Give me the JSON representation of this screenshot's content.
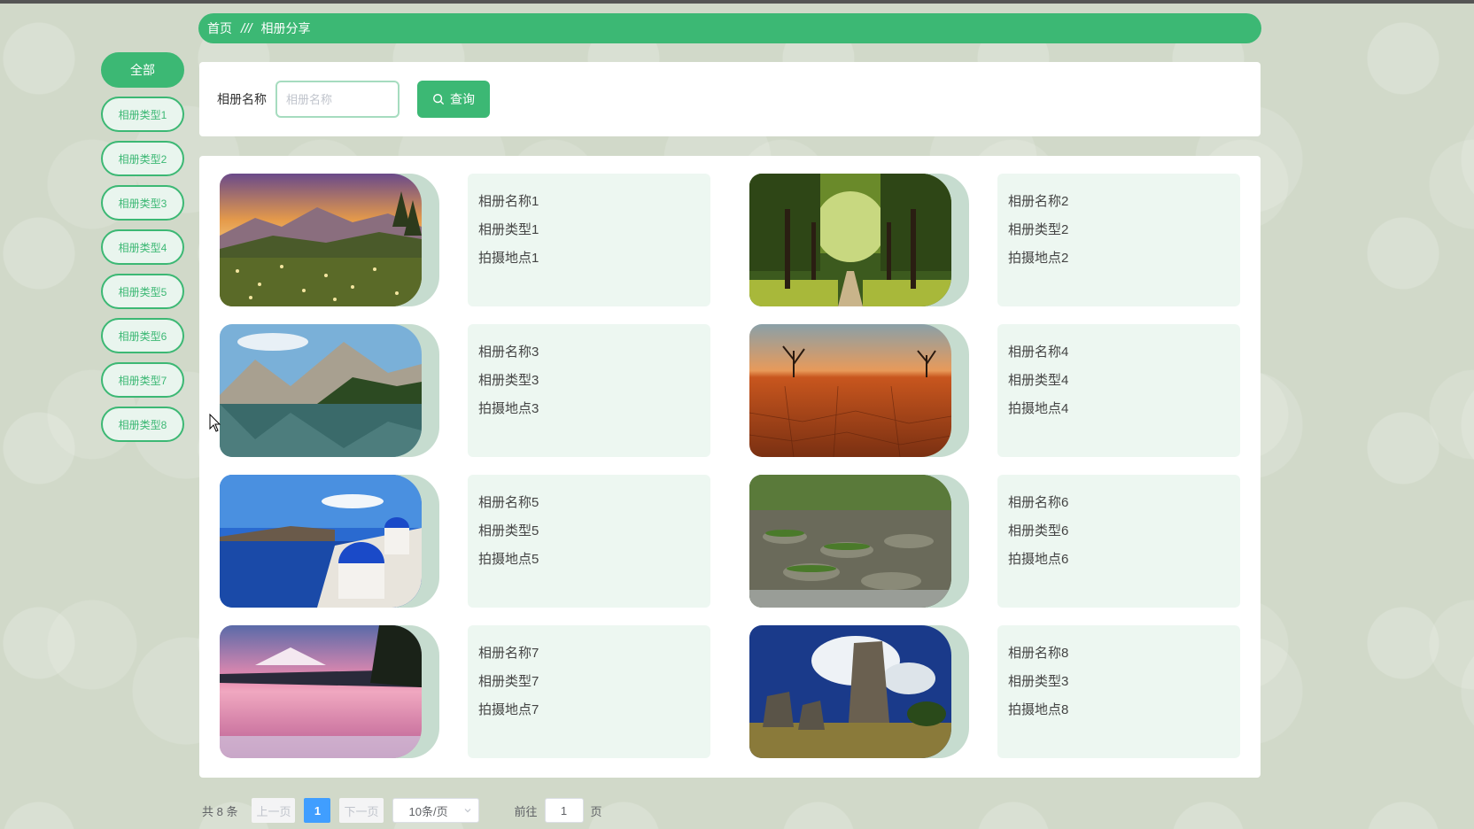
{
  "breadcrumb": {
    "home": "首页",
    "separator": "///",
    "current": "相册分享"
  },
  "sidebar": {
    "items": [
      {
        "label": "全部",
        "active": true
      },
      {
        "label": "相册类型1"
      },
      {
        "label": "相册类型2"
      },
      {
        "label": "相册类型3"
      },
      {
        "label": "相册类型4"
      },
      {
        "label": "相册类型5"
      },
      {
        "label": "相册类型6"
      },
      {
        "label": "相册类型7"
      },
      {
        "label": "相册类型8"
      }
    ]
  },
  "search": {
    "label": "相册名称",
    "placeholder": "相册名称",
    "value": "",
    "button_label": "查询",
    "button_icon": "search-icon"
  },
  "albums": [
    {
      "name": "相册名称1",
      "type": "相册类型1",
      "location": "拍摄地点1",
      "photo": "mountain-meadow-sunset"
    },
    {
      "name": "相册名称2",
      "type": "相册类型2",
      "location": "拍摄地点2",
      "photo": "tree-lined-road"
    },
    {
      "name": "相册名称3",
      "type": "相册类型3",
      "location": "拍摄地点3",
      "photo": "alpine-lake"
    },
    {
      "name": "相册名称4",
      "type": "相册类型4",
      "location": "拍摄地点4",
      "photo": "desert-dead-trees"
    },
    {
      "name": "相册名称5",
      "type": "相册类型5",
      "location": "拍摄地点5",
      "photo": "santorini-domes"
    },
    {
      "name": "相册名称6",
      "type": "相册类型6",
      "location": "拍摄地点6",
      "photo": "forest-stream"
    },
    {
      "name": "相册名称7",
      "type": "相册类型7",
      "location": "拍摄地点7",
      "photo": "pink-lake-volcano"
    },
    {
      "name": "相册名称8",
      "type": "相册类型3",
      "location": "拍摄地点8",
      "photo": "stone-forest"
    }
  ],
  "pagination": {
    "total": "共 8 条",
    "prev_label": "上一页",
    "current_page": "1",
    "next_label": "下一页",
    "page_size": "10条/页",
    "goto_label": "前往",
    "goto_value": "1",
    "page_suffix": "页"
  },
  "colors": {
    "accent": "#3cb874",
    "info_bg": "#edf7f1",
    "page_active": "#409eff"
  }
}
